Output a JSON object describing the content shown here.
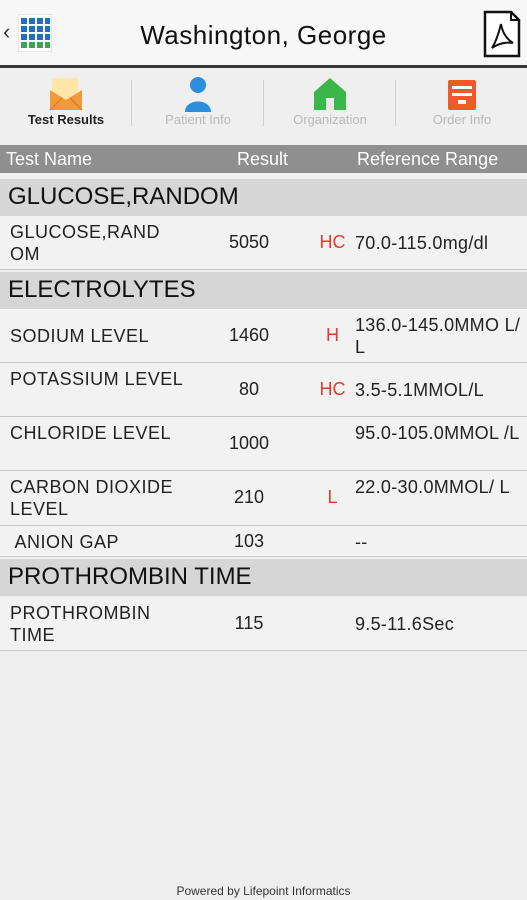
{
  "header": {
    "back_glyph": "‹",
    "title": "Washington, George"
  },
  "tabs": [
    {
      "label": "Test Results",
      "icon": "envelope-icon",
      "color": "#f29a3a"
    },
    {
      "label": "Patient Info",
      "icon": "person-icon",
      "color": "#2b8fe0"
    },
    {
      "label": "Organization",
      "icon": "house-icon",
      "color": "#3cb54a"
    },
    {
      "label": "Order Info",
      "icon": "toolbox-icon",
      "color": "#f05a2a"
    }
  ],
  "columns": {
    "name": "Test Name",
    "result": "Result",
    "range": "Reference Range"
  },
  "sections": [
    {
      "title": "GLUCOSE,RANDOM"
    },
    {
      "title": "ELECTROLYTES"
    },
    {
      "title": "PROTHROMBIN TIME"
    }
  ],
  "rows": [
    {
      "name": "GLUCOSE,RAND OM",
      "result": "5050",
      "flag": "HC",
      "range": "70.0-115.0mg/dl"
    },
    {
      "name": "SODIUM LEVEL",
      "result": "1460",
      "flag": "H",
      "range": "136.0-145.0MMO L/L"
    },
    {
      "name": "POTASSIUM LEVEL",
      "result": "80",
      "flag": "HC",
      "range": "3.5-5.1MMOL/L"
    },
    {
      "name": "CHLORIDE LEVEL",
      "result": "1000",
      "flag": "",
      "range": "95.0-105.0MMOL /L"
    },
    {
      "name": "CARBON DIOXIDE LEVEL",
      "result": "210",
      "flag": "L",
      "range": "22.0-30.0MMOL/ L"
    },
    {
      "name": " ANION GAP",
      "result": "103",
      "flag": "",
      "range": "--"
    },
    {
      "name": "PROTHROMBIN TIME",
      "result": "115",
      "flag": "",
      "range": "9.5-11.6Sec"
    }
  ],
  "footer": "Powered by Lifepoint Informatics",
  "colors": {
    "header_border": "#3a3a3a",
    "column_header_bg": "#8f8f8f",
    "section_bg": "#d6d6d6",
    "flag_red": "#e23b2e"
  }
}
